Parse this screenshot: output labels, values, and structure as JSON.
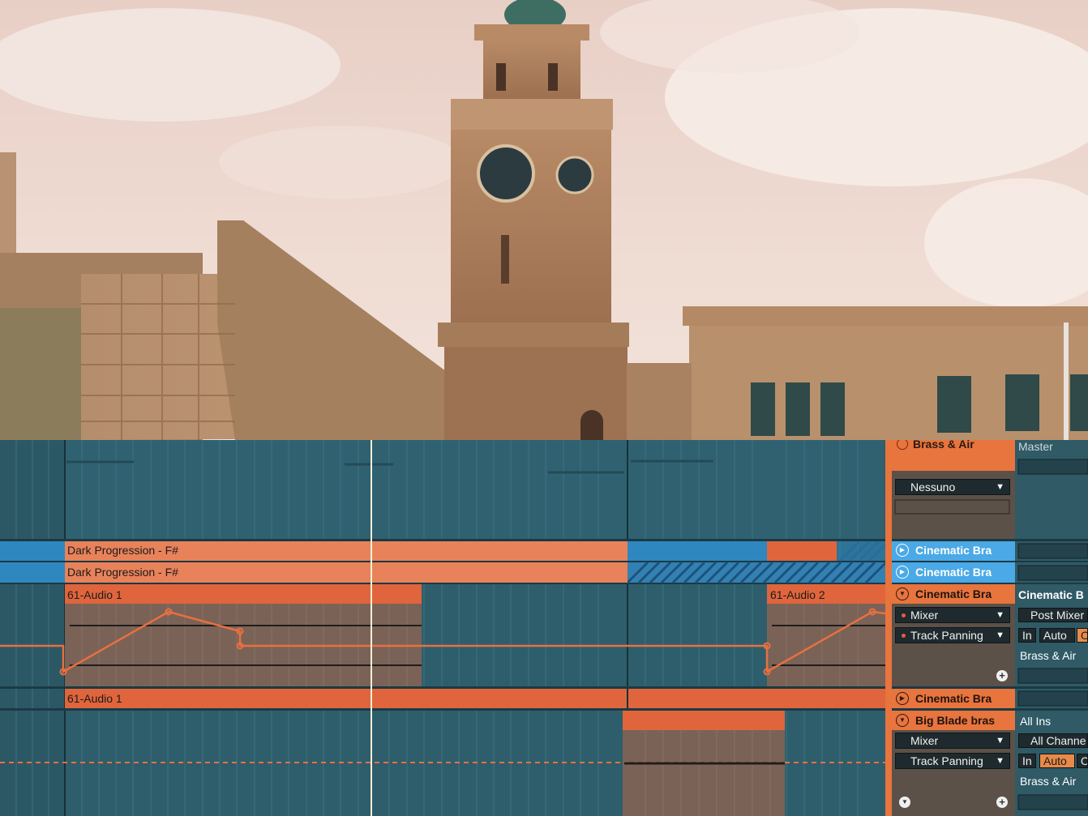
{
  "colors": {
    "clip_orange": "#e8825a",
    "clip_orange_dark": "#e0653c",
    "track_blue": "#2f87c0",
    "panel_orange": "#e8743e",
    "track_button_blue": "#4aa9e6",
    "arrangement_bg": "#2e5e6c"
  },
  "tracks": {
    "group_title": "Brass & Air",
    "input_select": "Nessuno",
    "track1_name": "Cinematic Bra",
    "track2_name": "Cinematic Bra",
    "track3_name": "Cinematic Bra",
    "track3_device": "Mixer",
    "track3_param": "Track Panning",
    "track4_name": "Cinematic Bra",
    "track5_name": "Big Blade bras",
    "track5_device": "Mixer",
    "track5_param": "Track Panning"
  },
  "io": {
    "master": "Master",
    "track3_input": "Cinematic B",
    "track3_tap": "Post Mixer",
    "monitor_in": "In",
    "monitor_auto": "Auto",
    "monitor_off_partial": "O",
    "track3_output": "Brass & Air",
    "track5_input": "All Ins",
    "track5_channel": "All Channe",
    "track5_output": "Brass & Air"
  },
  "clips": {
    "dark1": "Dark Progression - F#",
    "dark2": "Dark Progression - F#",
    "audio1": "61-Audio 1",
    "audio2": "61-Audio 2",
    "audio1b": "61-Audio 1"
  }
}
